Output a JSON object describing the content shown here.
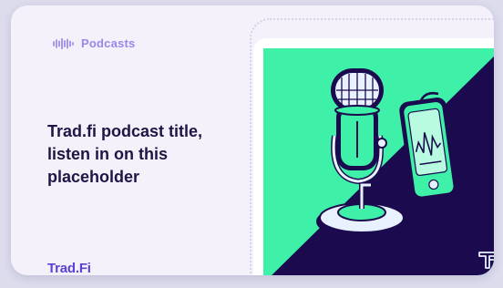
{
  "card": {
    "category": "Podcasts",
    "title": "Trad.fi podcast title, listen in on this placeholder",
    "brand": "Trad.Fi"
  },
  "icons": {
    "category": "soundwave-icon",
    "illustration": "microphone-and-phone-illustration",
    "corner": "trad-fi-monogram-icon"
  },
  "colors": {
    "card_background": "#f4f1fb",
    "accent": "#9b86ea",
    "title": "#1f1645",
    "brand": "#5a42d6",
    "art_green": "#3ef0a8",
    "art_navy": "#1b0a4e"
  }
}
